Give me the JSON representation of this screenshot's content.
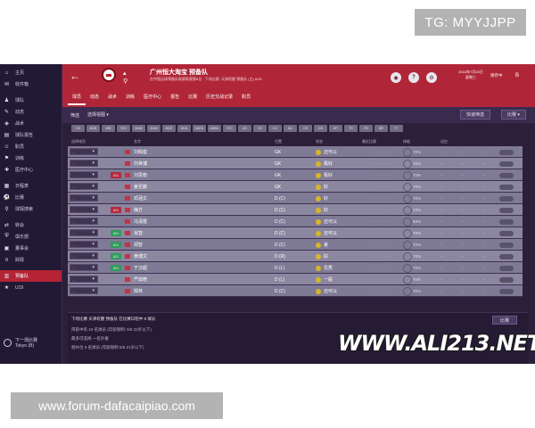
{
  "badges": {
    "tg": "TG: MYYJJPP",
    "forum": "www.forum-dafacaipiao.com"
  },
  "sidebar": {
    "items": [
      {
        "label": "主页",
        "icon": "home-icon"
      },
      {
        "label": "收件箱",
        "icon": "inbox-icon"
      },
      {
        "label": "球队",
        "icon": "squad-icon"
      },
      {
        "label": "动态",
        "icon": "news-icon"
      },
      {
        "label": "战术",
        "icon": "tactics-icon"
      },
      {
        "label": "球队报告",
        "icon": "report-icon"
      },
      {
        "label": "职员",
        "icon": "staff-icon"
      },
      {
        "label": "训练",
        "icon": "training-icon"
      },
      {
        "label": "医疗中心",
        "icon": "medical-icon"
      },
      {
        "label": "日程表",
        "icon": "calendar-icon"
      },
      {
        "label": "比赛",
        "icon": "match-icon"
      },
      {
        "label": "球探搜索",
        "icon": "scouting-icon"
      },
      {
        "label": "转会",
        "icon": "transfer-icon"
      },
      {
        "label": "俱乐部",
        "icon": "club-icon"
      },
      {
        "label": "董事会",
        "icon": "board-icon"
      },
      {
        "label": "财政",
        "icon": "finance-icon"
      },
      {
        "label": "预备队",
        "icon": "reserve-icon"
      },
      {
        "label": "U19",
        "icon": "youth-icon"
      }
    ],
    "active_index": 16,
    "bottom_label": "下一场比赛",
    "bottom_city": "Tokyo (B)"
  },
  "header": {
    "title": "广州恒大淘宝 预备队",
    "subtitle": "在中国足球预备队联赛联赛第8位 · 下场比赛: 天津权健 预备队 (主) 8/30",
    "date": "2018年7月15日",
    "weekday": "星期三",
    "save_label": "保存中",
    "user_initial": "B"
  },
  "nav_tabs": [
    "球员",
    "动态",
    "战术",
    "训练",
    "医疗中心",
    "报告",
    "比赛",
    "历史交战记录",
    "职员"
  ],
  "filter": {
    "label": "筛选",
    "select_value": "选择视图 ▾",
    "quick_pick": "快速筛选",
    "right_button": "比赛 ▾"
  },
  "column_pills": [
    "GK",
    "MCB",
    "WB",
    "TEG",
    "MAM",
    "MAM",
    "MCE",
    "MCA",
    "MATA",
    "AMML",
    "STC",
    "AS",
    "OS",
    "KX",
    "BA",
    "CE",
    "DS",
    "WT",
    "TR",
    "FB",
    "BR",
    "TT"
  ],
  "table": {
    "headers": [
      "选择球员",
      "",
      "名字",
      "位置",
      "状态",
      "最近比赛",
      "体能",
      "适应",
      "",
      "",
      "",
      ""
    ],
    "rows": [
      {
        "drop": "-",
        "tag": "",
        "name": "刘殿座",
        "pos": "GK",
        "cond": "还可以",
        "pct": "70%"
      },
      {
        "drop": "-",
        "tag": "",
        "name": "刘世博",
        "pos": "GK",
        "cond": "极好",
        "pct": "70%"
      },
      {
        "drop": "-",
        "tag": "U21",
        "tag_color": "red",
        "name": "刘思衡",
        "pos": "GK",
        "cond": "极好",
        "pct": "70%"
      },
      {
        "drop": "-",
        "tag": "",
        "name": "姜至鹏",
        "pos": "GK",
        "cond": "好",
        "pct": "70%"
      },
      {
        "drop": "-",
        "tag": "",
        "name": "邓涵文",
        "pos": "D (C)",
        "cond": "好",
        "pct": "70%"
      },
      {
        "drop": "-",
        "tag": "U21",
        "tag_color": "red",
        "name": "梅方",
        "pos": "D (C)",
        "cond": "好",
        "pct": "70%"
      },
      {
        "drop": "-",
        "tag": "",
        "name": "冯潇霆",
        "pos": "D (C)",
        "cond": "还可以",
        "pct": "50%"
      },
      {
        "drop": "-",
        "tag": "U21",
        "tag_color": "green",
        "name": "肖智",
        "pos": "D (C)",
        "cond": "还可以",
        "pct": "70%"
      },
      {
        "drop": "-",
        "tag": "U21",
        "tag_color": "green",
        "name": "郑智",
        "pos": "D (C)",
        "cond": "差",
        "pct": "70%"
      },
      {
        "drop": "-",
        "tag": "U21",
        "tag_color": "green",
        "name": "黄博文",
        "pos": "D (R)",
        "cond": "好",
        "pct": "70%"
      },
      {
        "drop": "-",
        "tag": "U21",
        "tag_color": "green",
        "name": "于汉超",
        "pos": "D (L)",
        "cond": "优秀",
        "pct": "70%"
      },
      {
        "drop": "-",
        "tag": "",
        "name": "严鼎皓",
        "pos": "D (L)",
        "cond": "一般",
        "pct": "70%"
      },
      {
        "drop": "-",
        "tag": "",
        "name": "郜林",
        "pos": "D (C)",
        "cond": "还可以",
        "pct": "70%"
      }
    ]
  },
  "bottom_panel": {
    "head": "下场比赛 天津权健 预备队 在比赛日程中 9 球员",
    "lines": [
      "阵容中有 16 名球员 (年龄限制: 5/5 23岁以下)",
      "最多可选择 一名外援",
      "替补位 9 名球员 (年龄限制 5/5 21岁以下)"
    ],
    "button": "比赛"
  },
  "watermark": "WWW.ALI213.NET"
}
